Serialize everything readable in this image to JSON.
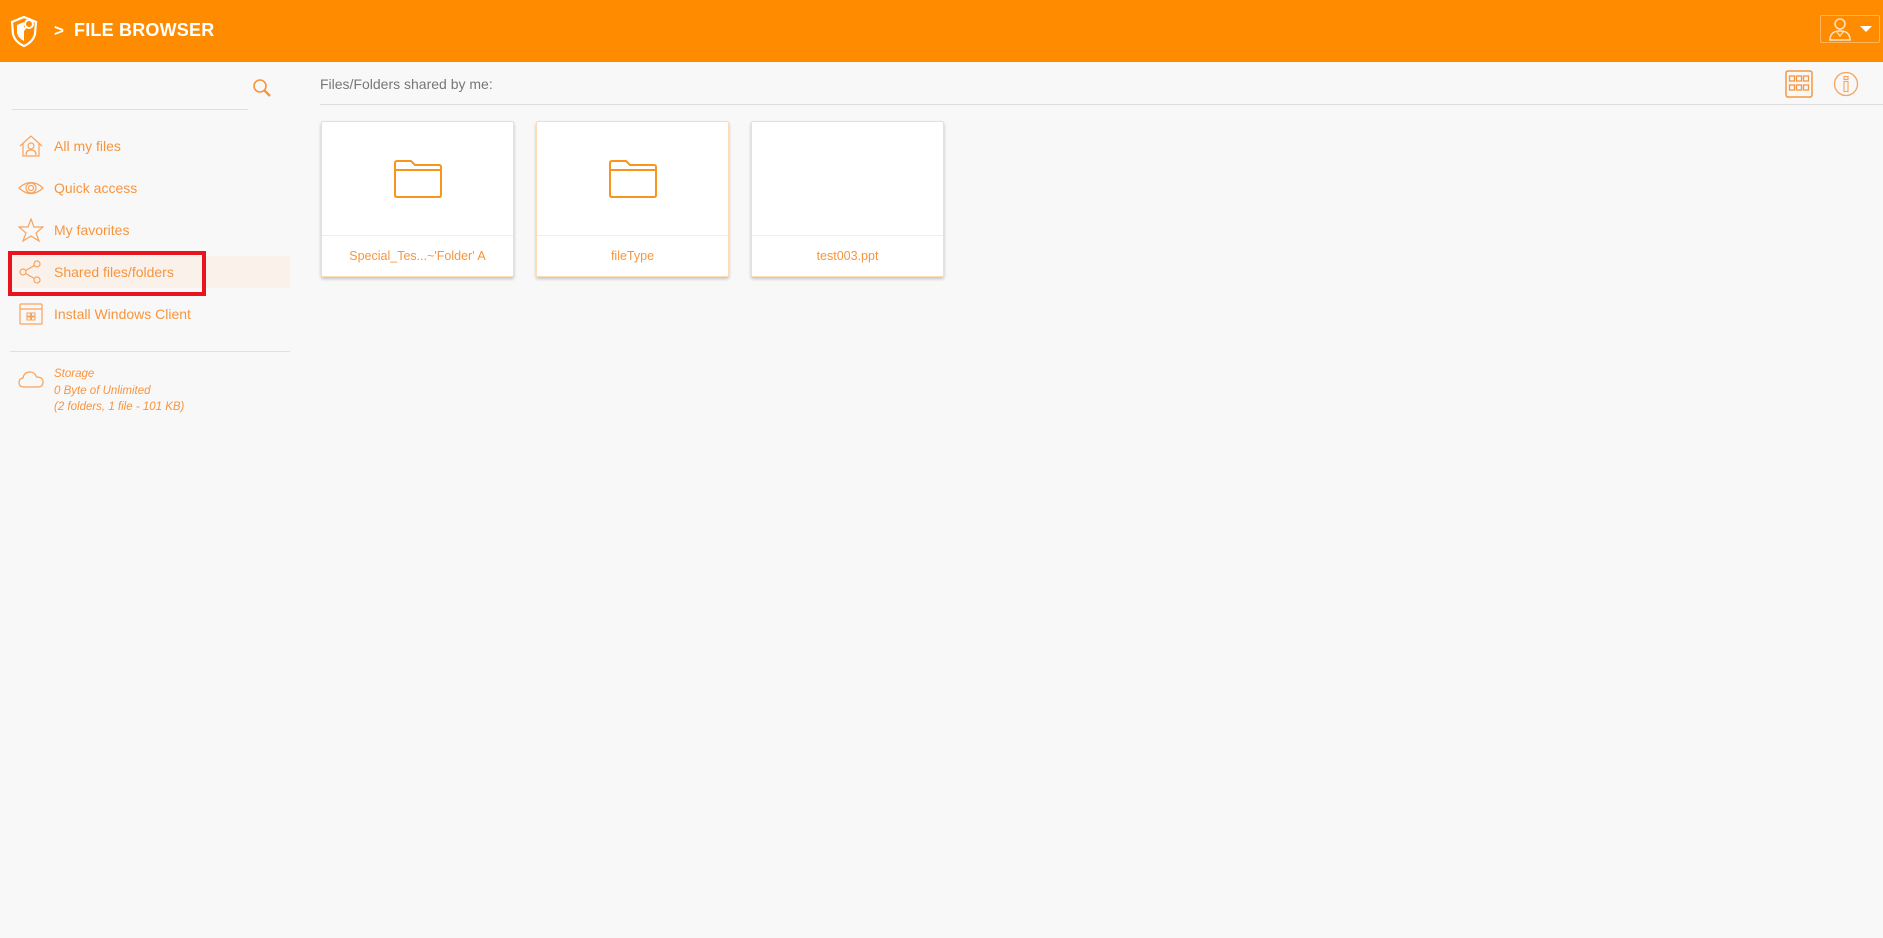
{
  "header": {
    "breadcrumb_separator": ">",
    "title": "FILE BROWSER",
    "brand_color": "#ff8c00"
  },
  "sidebar": {
    "search": {
      "value": "",
      "placeholder": ""
    },
    "items": [
      {
        "label": "All my files",
        "icon": "home-user-icon",
        "active": false
      },
      {
        "label": "Quick access",
        "icon": "eye-icon",
        "active": false
      },
      {
        "label": "My favorites",
        "icon": "star-icon",
        "active": false
      },
      {
        "label": "Shared files/folders",
        "icon": "share-icon",
        "active": true
      },
      {
        "label": "Install Windows Client",
        "icon": "windows-client-icon",
        "active": false
      }
    ],
    "storage": {
      "label": "Storage",
      "usage": "0 Byte of Unlimited",
      "summary": "(2 folders, 1 file - 101 KB)"
    }
  },
  "main": {
    "title": "Files/Folders shared by me:",
    "items": [
      {
        "name": "Special_Tes...~'Folder' A",
        "type": "folder"
      },
      {
        "name": "fileType",
        "type": "folder"
      },
      {
        "name": "test003.ppt",
        "type": "file"
      }
    ]
  },
  "annotation": {
    "highlight_color": "#e8141e",
    "highlighted_item": "Shared files/folders"
  }
}
